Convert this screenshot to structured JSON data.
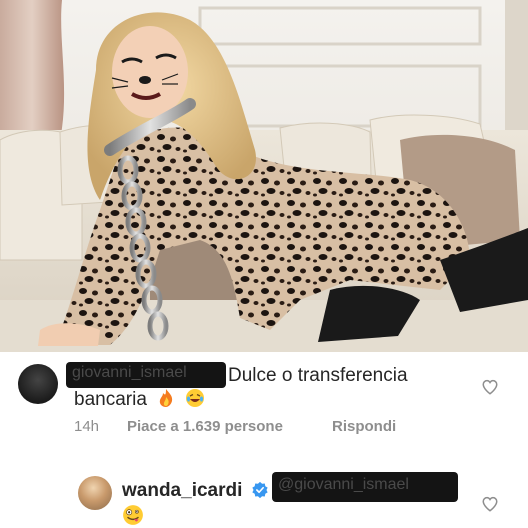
{
  "comment1": {
    "username_redacted": "giovanni_ismael",
    "text": "Dulce o transferencia",
    "text_line2": "bancaria",
    "emojis": [
      "fire-emoji",
      "laughing-emoji"
    ],
    "time": "14h",
    "likes": "Piace a 1.639 persone",
    "reply": "Rispondi"
  },
  "comment2": {
    "username": "wanda_icardi",
    "mention_redacted": "@giovanni_ismael",
    "emojis": [
      "zany-face-emoji"
    ]
  },
  "icons": {
    "like": "heart-icon",
    "verified": "verified-badge-icon"
  },
  "colors": {
    "text": "#262626",
    "meta": "#8e8e8e",
    "verified": "#3897f0",
    "redaction": "#141414"
  }
}
